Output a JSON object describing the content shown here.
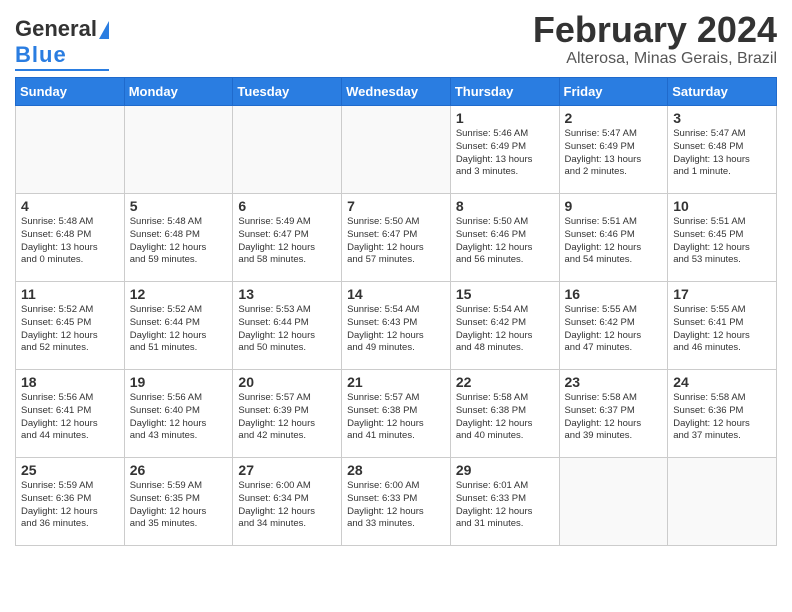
{
  "header": {
    "logo_general": "General",
    "logo_blue": "Blue",
    "month": "February 2024",
    "location": "Alterosa, Minas Gerais, Brazil"
  },
  "days_of_week": [
    "Sunday",
    "Monday",
    "Tuesday",
    "Wednesday",
    "Thursday",
    "Friday",
    "Saturday"
  ],
  "weeks": [
    [
      {
        "day": "",
        "info": ""
      },
      {
        "day": "",
        "info": ""
      },
      {
        "day": "",
        "info": ""
      },
      {
        "day": "",
        "info": ""
      },
      {
        "day": "1",
        "info": "Sunrise: 5:46 AM\nSunset: 6:49 PM\nDaylight: 13 hours\nand 3 minutes."
      },
      {
        "day": "2",
        "info": "Sunrise: 5:47 AM\nSunset: 6:49 PM\nDaylight: 13 hours\nand 2 minutes."
      },
      {
        "day": "3",
        "info": "Sunrise: 5:47 AM\nSunset: 6:48 PM\nDaylight: 13 hours\nand 1 minute."
      }
    ],
    [
      {
        "day": "4",
        "info": "Sunrise: 5:48 AM\nSunset: 6:48 PM\nDaylight: 13 hours\nand 0 minutes."
      },
      {
        "day": "5",
        "info": "Sunrise: 5:48 AM\nSunset: 6:48 PM\nDaylight: 12 hours\nand 59 minutes."
      },
      {
        "day": "6",
        "info": "Sunrise: 5:49 AM\nSunset: 6:47 PM\nDaylight: 12 hours\nand 58 minutes."
      },
      {
        "day": "7",
        "info": "Sunrise: 5:50 AM\nSunset: 6:47 PM\nDaylight: 12 hours\nand 57 minutes."
      },
      {
        "day": "8",
        "info": "Sunrise: 5:50 AM\nSunset: 6:46 PM\nDaylight: 12 hours\nand 56 minutes."
      },
      {
        "day": "9",
        "info": "Sunrise: 5:51 AM\nSunset: 6:46 PM\nDaylight: 12 hours\nand 54 minutes."
      },
      {
        "day": "10",
        "info": "Sunrise: 5:51 AM\nSunset: 6:45 PM\nDaylight: 12 hours\nand 53 minutes."
      }
    ],
    [
      {
        "day": "11",
        "info": "Sunrise: 5:52 AM\nSunset: 6:45 PM\nDaylight: 12 hours\nand 52 minutes."
      },
      {
        "day": "12",
        "info": "Sunrise: 5:52 AM\nSunset: 6:44 PM\nDaylight: 12 hours\nand 51 minutes."
      },
      {
        "day": "13",
        "info": "Sunrise: 5:53 AM\nSunset: 6:44 PM\nDaylight: 12 hours\nand 50 minutes."
      },
      {
        "day": "14",
        "info": "Sunrise: 5:54 AM\nSunset: 6:43 PM\nDaylight: 12 hours\nand 49 minutes."
      },
      {
        "day": "15",
        "info": "Sunrise: 5:54 AM\nSunset: 6:42 PM\nDaylight: 12 hours\nand 48 minutes."
      },
      {
        "day": "16",
        "info": "Sunrise: 5:55 AM\nSunset: 6:42 PM\nDaylight: 12 hours\nand 47 minutes."
      },
      {
        "day": "17",
        "info": "Sunrise: 5:55 AM\nSunset: 6:41 PM\nDaylight: 12 hours\nand 46 minutes."
      }
    ],
    [
      {
        "day": "18",
        "info": "Sunrise: 5:56 AM\nSunset: 6:41 PM\nDaylight: 12 hours\nand 44 minutes."
      },
      {
        "day": "19",
        "info": "Sunrise: 5:56 AM\nSunset: 6:40 PM\nDaylight: 12 hours\nand 43 minutes."
      },
      {
        "day": "20",
        "info": "Sunrise: 5:57 AM\nSunset: 6:39 PM\nDaylight: 12 hours\nand 42 minutes."
      },
      {
        "day": "21",
        "info": "Sunrise: 5:57 AM\nSunset: 6:38 PM\nDaylight: 12 hours\nand 41 minutes."
      },
      {
        "day": "22",
        "info": "Sunrise: 5:58 AM\nSunset: 6:38 PM\nDaylight: 12 hours\nand 40 minutes."
      },
      {
        "day": "23",
        "info": "Sunrise: 5:58 AM\nSunset: 6:37 PM\nDaylight: 12 hours\nand 39 minutes."
      },
      {
        "day": "24",
        "info": "Sunrise: 5:58 AM\nSunset: 6:36 PM\nDaylight: 12 hours\nand 37 minutes."
      }
    ],
    [
      {
        "day": "25",
        "info": "Sunrise: 5:59 AM\nSunset: 6:36 PM\nDaylight: 12 hours\nand 36 minutes."
      },
      {
        "day": "26",
        "info": "Sunrise: 5:59 AM\nSunset: 6:35 PM\nDaylight: 12 hours\nand 35 minutes."
      },
      {
        "day": "27",
        "info": "Sunrise: 6:00 AM\nSunset: 6:34 PM\nDaylight: 12 hours\nand 34 minutes."
      },
      {
        "day": "28",
        "info": "Sunrise: 6:00 AM\nSunset: 6:33 PM\nDaylight: 12 hours\nand 33 minutes."
      },
      {
        "day": "29",
        "info": "Sunrise: 6:01 AM\nSunset: 6:33 PM\nDaylight: 12 hours\nand 31 minutes."
      },
      {
        "day": "",
        "info": ""
      },
      {
        "day": "",
        "info": ""
      }
    ]
  ]
}
